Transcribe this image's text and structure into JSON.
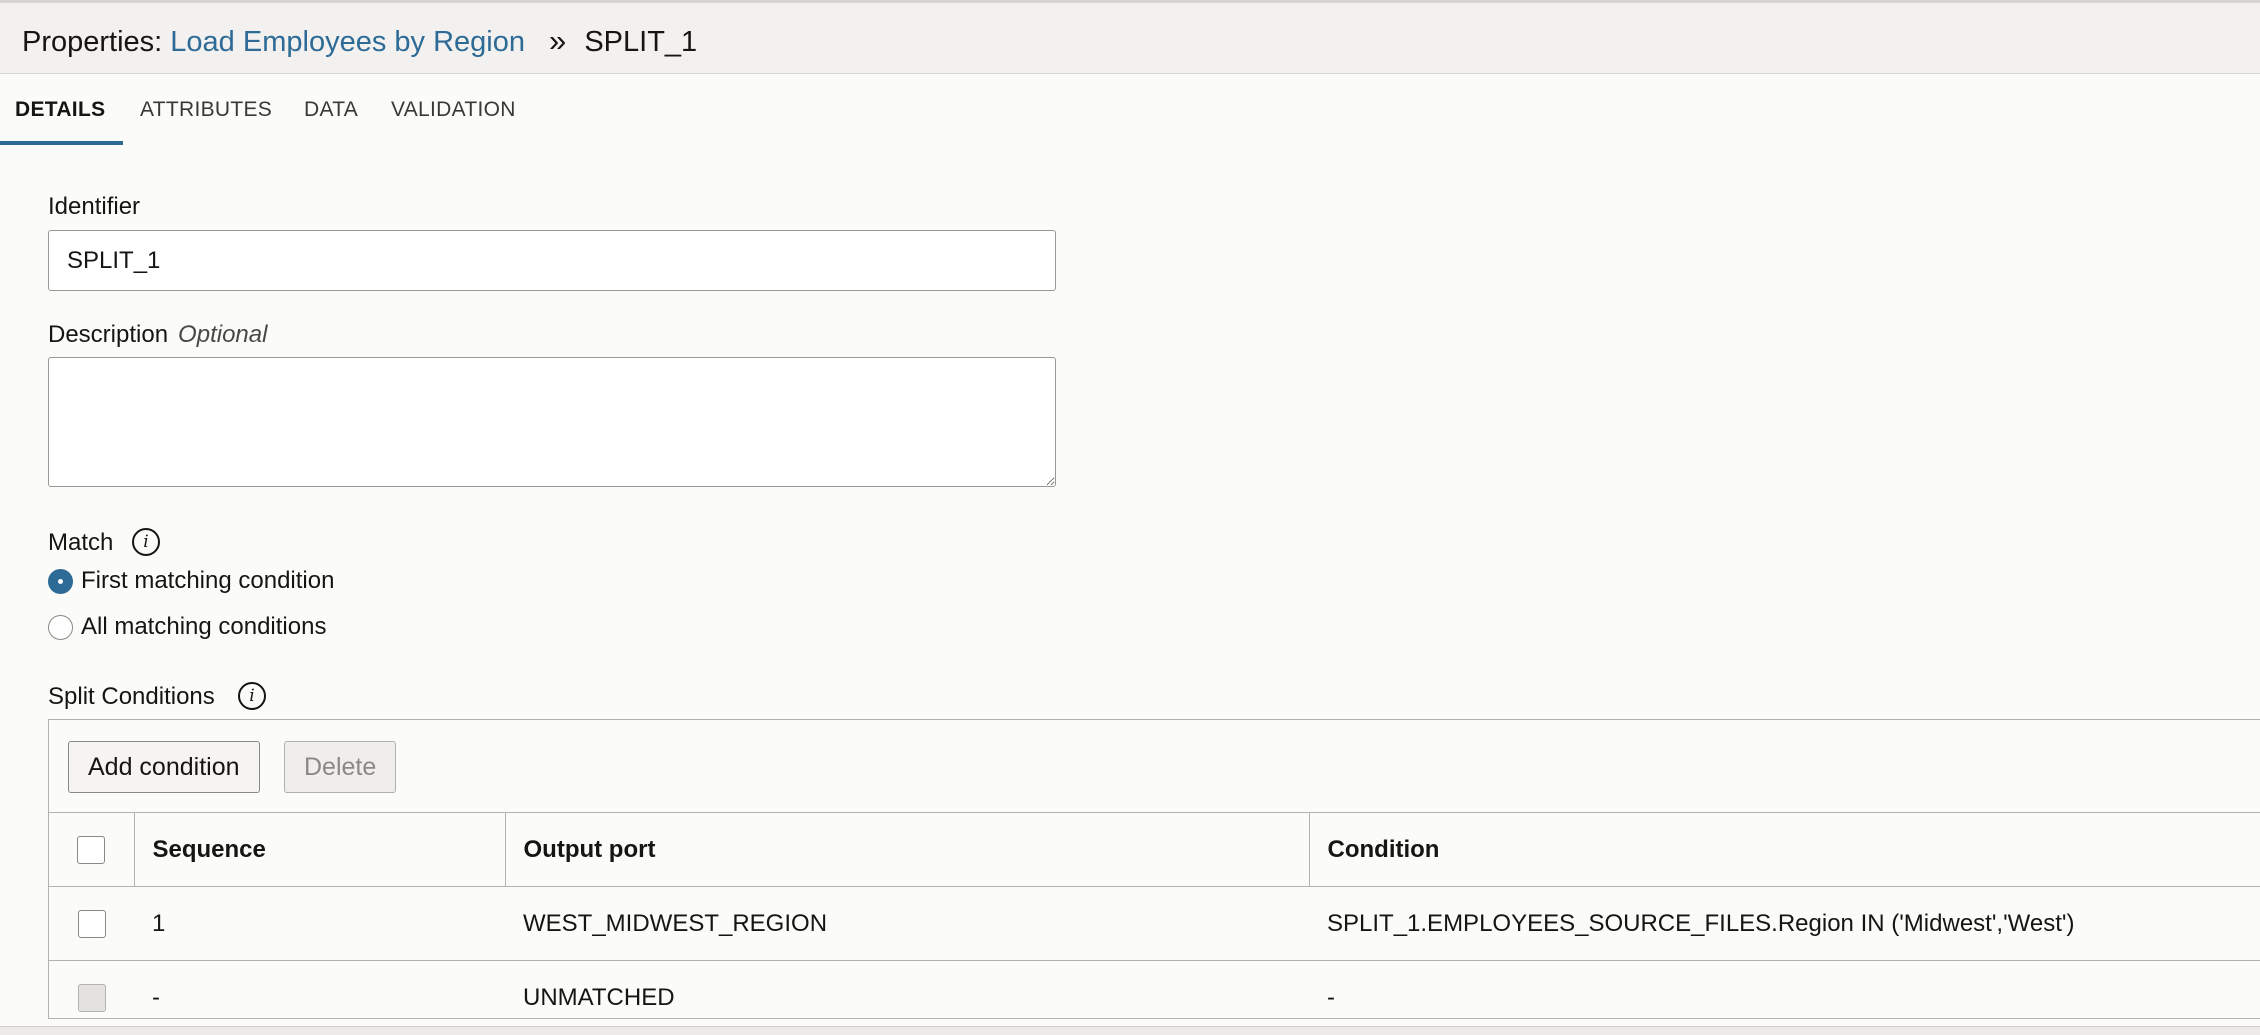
{
  "header": {
    "prefix": "Properties:",
    "link": "Load Employees by Region",
    "separator": "»",
    "current": "SPLIT_1"
  },
  "tabs": [
    {
      "label": "DETAILS",
      "active": true
    },
    {
      "label": "ATTRIBUTES",
      "active": false
    },
    {
      "label": "DATA",
      "active": false
    },
    {
      "label": "VALIDATION",
      "active": false
    }
  ],
  "form": {
    "identifier_label": "Identifier",
    "identifier_value": "SPLIT_1",
    "description_label": "Description",
    "description_optional": "Optional",
    "description_value": "",
    "match_label": "Match",
    "match_options": [
      {
        "label": "First matching condition",
        "selected": true
      },
      {
        "label": "All matching conditions",
        "selected": false
      }
    ]
  },
  "split_conditions": {
    "label": "Split Conditions",
    "add_button": "Add condition",
    "delete_button": "Delete",
    "columns": [
      "Sequence",
      "Output port",
      "Condition"
    ],
    "rows": [
      {
        "sequence": "1",
        "output_port": "WEST_MIDWEST_REGION",
        "condition": "SPLIT_1.EMPLOYEES_SOURCE_FILES.Region IN ('Midwest','West')"
      },
      {
        "sequence": "-",
        "output_port": "UNMATCHED",
        "condition": "-"
      }
    ]
  },
  "colors": {
    "accent": "#2d6b96",
    "background": "#fbfbf9",
    "header_bg": "#f2f1ef"
  }
}
